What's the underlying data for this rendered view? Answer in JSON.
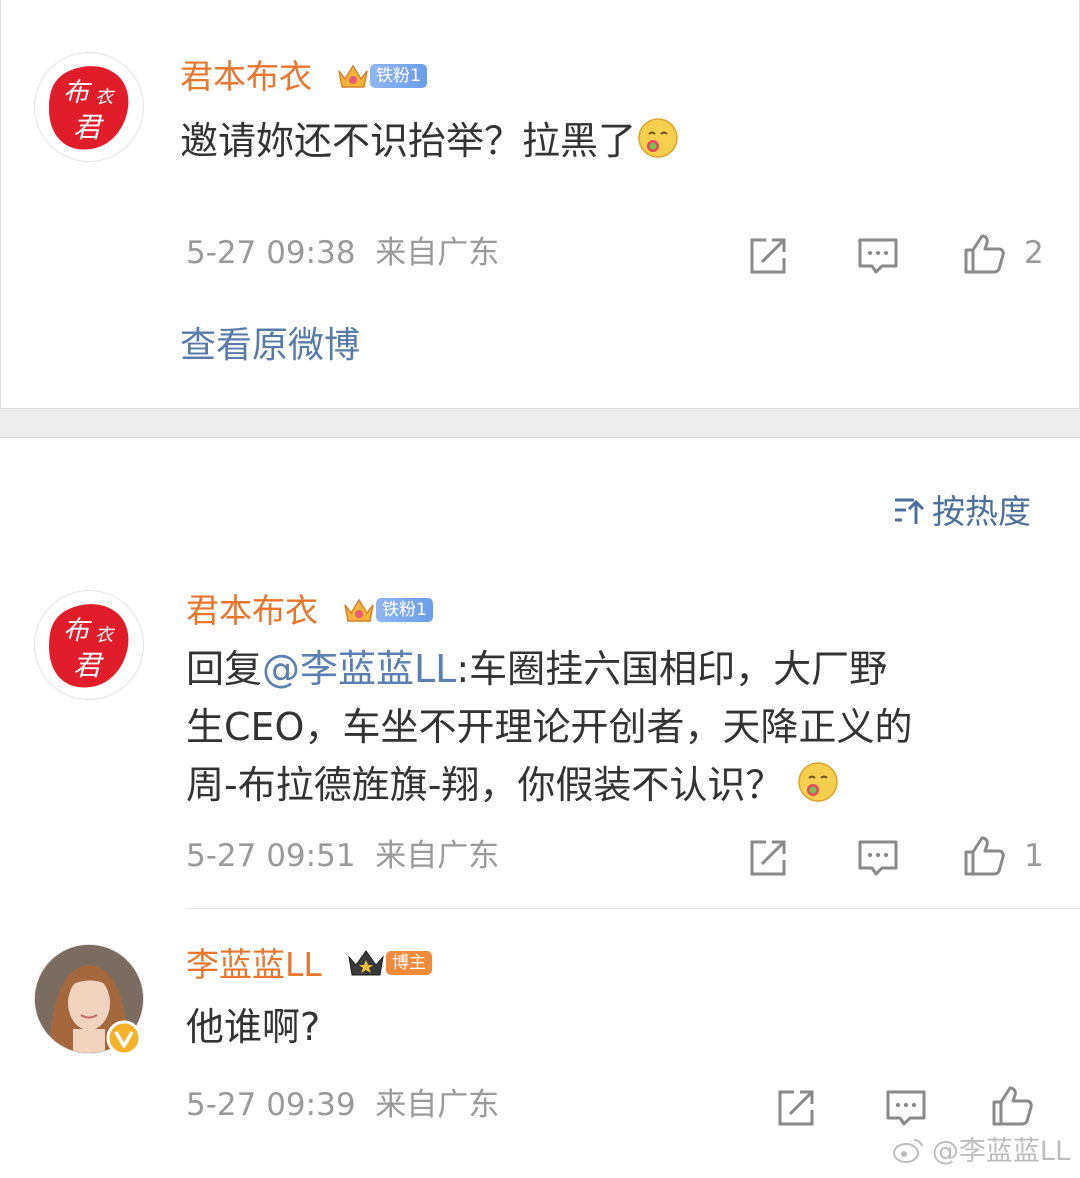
{
  "comments": [
    {
      "user": "君本布衣",
      "badge": "铁粉1",
      "text": "邀请妳还不识抬举？拉黑了",
      "time": "5-27 09:38",
      "location": "来自广东",
      "likes": "2"
    },
    {
      "user": "君本布衣",
      "badge": "铁粉1",
      "reply_prefix": "回复",
      "mention": "@李蓝蓝LL",
      "line1_rest": ":车圈挂六国相印，大厂野",
      "line2": "生CEO，车坐不开理论开创者，天降正义的",
      "line3": "周-布拉德旌旗-翔，你假装不认识？",
      "time": "5-27 09:51",
      "location": "来自广东",
      "likes": "1"
    },
    {
      "user": "李蓝蓝LL",
      "badge": "博主",
      "text": "他谁啊?",
      "time": "5-27 09:39",
      "location": "来自广东"
    }
  ],
  "view_original": "查看原微博",
  "sort_label": "按热度",
  "watermark": "@李蓝蓝LL",
  "colors": {
    "username": "#e8762c",
    "link": "#5a7ba8",
    "meta": "#9a9a9a",
    "fan_badge": "#7aa7ec",
    "host_badge": "#f08a3c"
  }
}
